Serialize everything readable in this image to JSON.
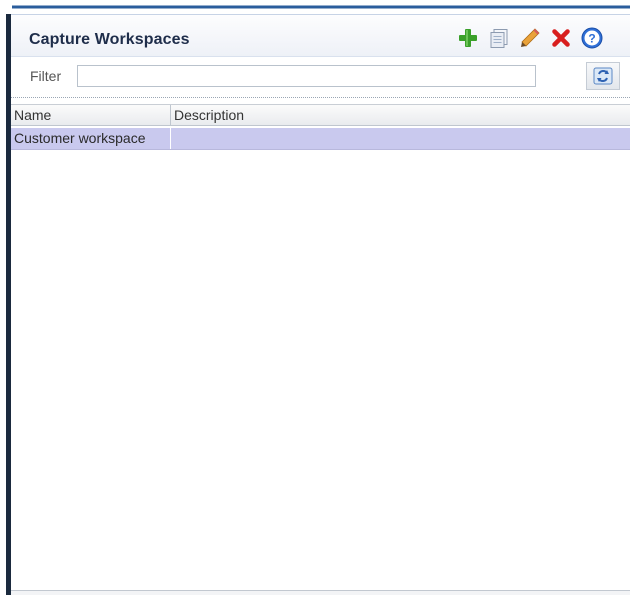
{
  "panel": {
    "title": "Capture Workspaces"
  },
  "toolbar": {
    "icons": [
      "add-icon",
      "copy-icon",
      "edit-icon",
      "delete-icon",
      "help-icon"
    ],
    "colors": {
      "add": "#3aa02a",
      "delete": "#d81e1e",
      "help": "#2f6fd6",
      "edit": "#e0a030"
    }
  },
  "filter": {
    "label": "Filter",
    "value": "",
    "placeholder": ""
  },
  "table": {
    "columns": [
      "Name",
      "Description"
    ],
    "rows": [
      {
        "name": "Customer workspace",
        "description": ""
      }
    ],
    "selected_row_color": "#c9c9ee"
  }
}
